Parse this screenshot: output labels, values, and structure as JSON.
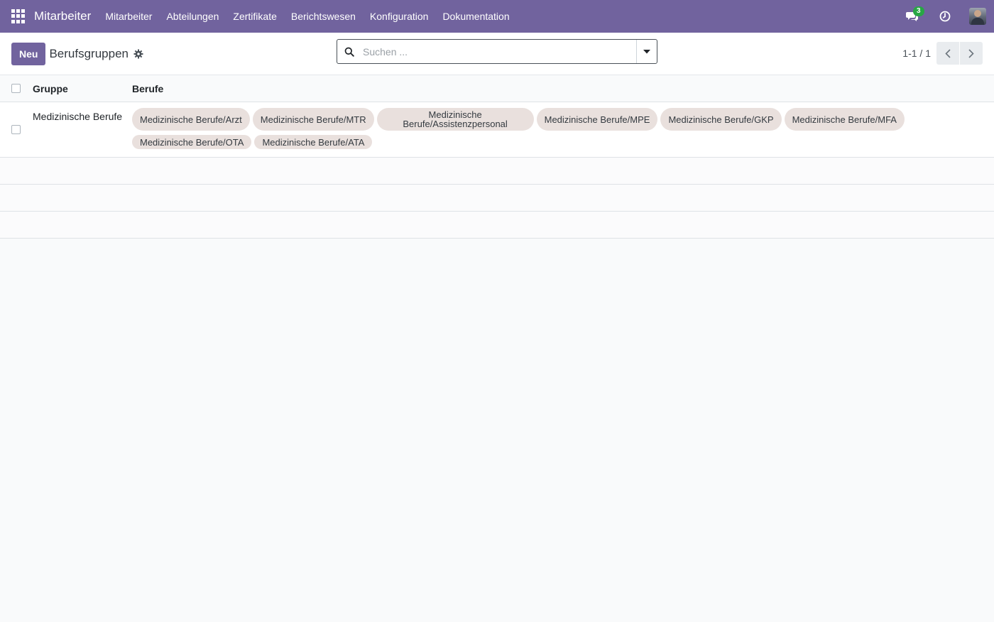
{
  "navbar": {
    "brand": "Mitarbeiter",
    "menu": [
      "Mitarbeiter",
      "Abteilungen",
      "Zertifikate",
      "Berichtswesen",
      "Konfiguration",
      "Dokumentation"
    ],
    "chat_count": "3"
  },
  "control": {
    "new_label": "Neu",
    "title": "Berufsgruppen",
    "search_placeholder": "Suchen ...",
    "pager_value": "1-1 / 1"
  },
  "list": {
    "columns": {
      "group": "Gruppe",
      "professions": "Berufe"
    },
    "rows": [
      {
        "group": "Medizinische Berufe",
        "tags": [
          "Medizinische Berufe/Arzt",
          "Medizinische Berufe/MTR",
          "Medizinische Berufe/Assistenzpersonal",
          "Medizinische Berufe/MPE",
          "Medizinische Berufe/GKP",
          "Medizinische Berufe/MFA",
          "Medizinische Berufe/OTA",
          "Medizinische Berufe/ATA"
        ]
      }
    ]
  },
  "colors": {
    "brand": "#71639e",
    "tag_bg": "#e9e0dd",
    "badge": "#28a745"
  }
}
